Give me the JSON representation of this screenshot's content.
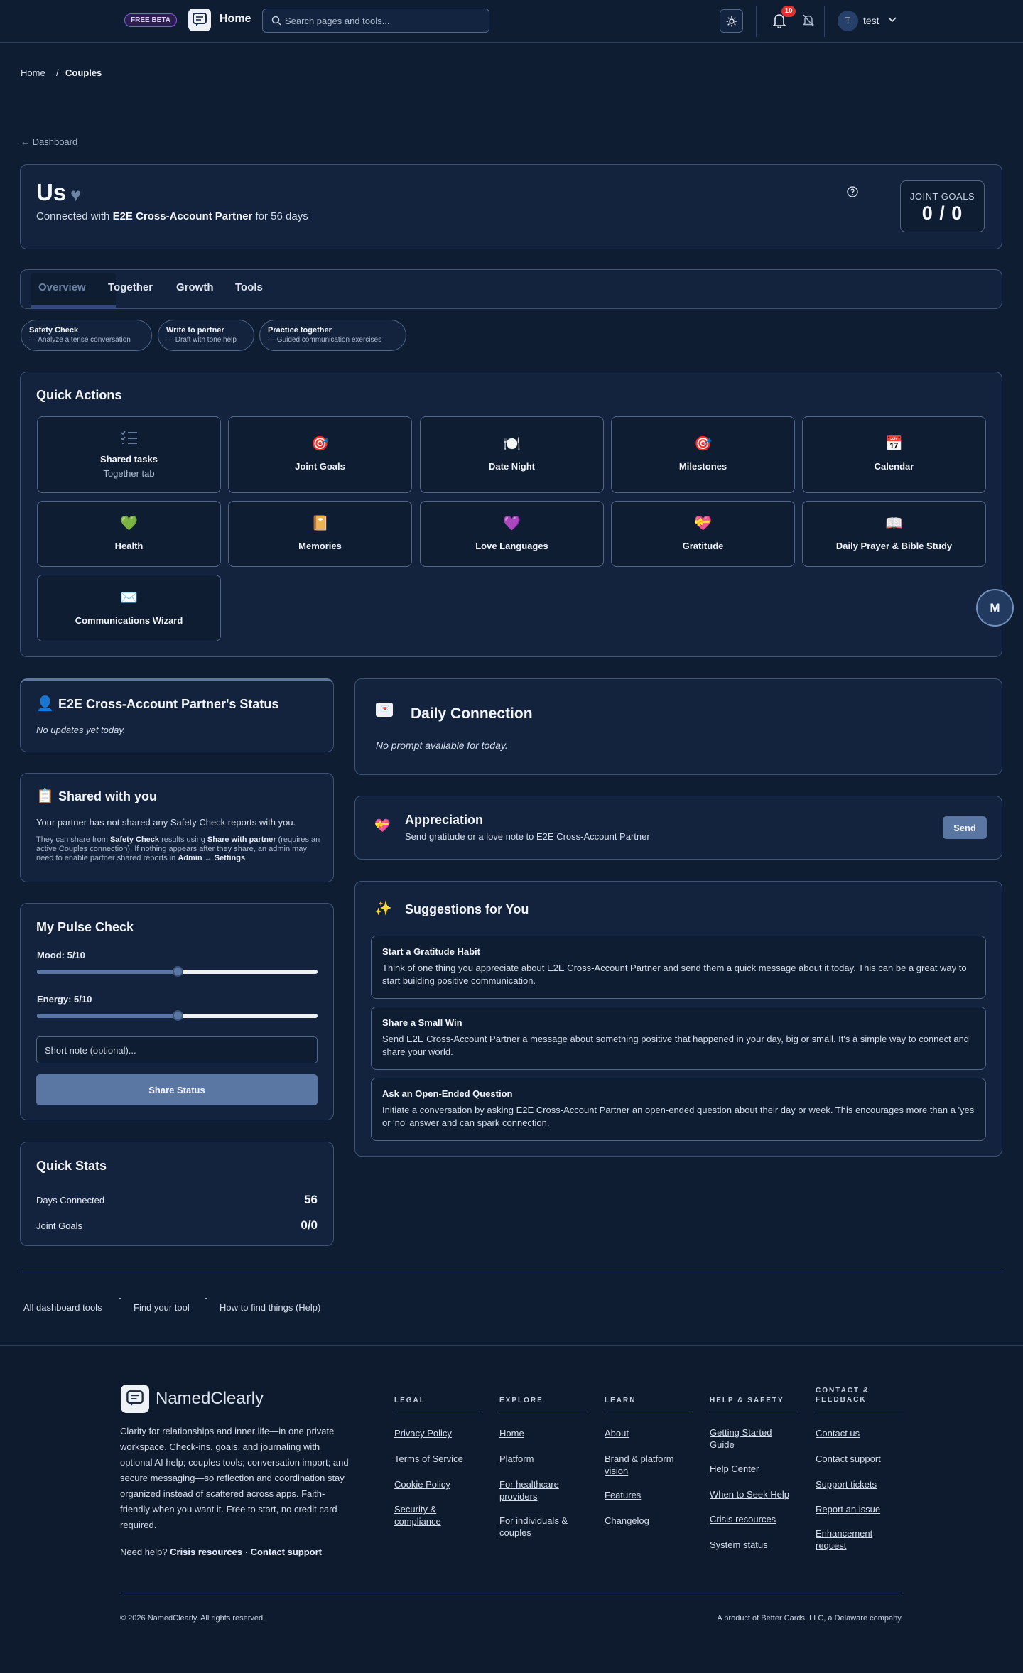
{
  "header": {
    "beta_badge": "FREE BETA",
    "home_label": "Home",
    "search_placeholder": "Search pages and tools...",
    "notifications_count": "10",
    "user_initial": "T",
    "user_name": "test"
  },
  "breadcrumb": {
    "home": "Home",
    "separator": "/",
    "current": "Couples"
  },
  "back_link": "← Dashboard",
  "hero": {
    "title": "Us",
    "heart": "♥",
    "subtitle_prefix": "Connected with ",
    "partner_name": "E2E Cross-Account Partner",
    "subtitle_suffix": " for 56 days",
    "joint_goals_label": "JOINT GOALS",
    "joint_goals_value": "0 / 0"
  },
  "tabs": [
    "Overview",
    "Together",
    "Growth",
    "Tools"
  ],
  "pills": [
    {
      "title": "Safety Check",
      "sub": "— Analyze a tense conversation"
    },
    {
      "title": "Write to partner",
      "sub": "— Draft with tone help"
    },
    {
      "title": "Practice together",
      "sub": "— Guided communication exercises"
    }
  ],
  "quick_actions": {
    "title": "Quick Actions",
    "items": [
      {
        "icon": "🎯",
        "label": "Joint Goals"
      },
      {
        "icon": "🍽️",
        "label": "Date Night"
      },
      {
        "icon": "🎯",
        "label": "Milestones"
      },
      {
        "icon": "📅",
        "label": "Calendar"
      },
      {
        "icon": "💚",
        "label": "Health"
      },
      {
        "icon": "📔",
        "label": "Memories"
      },
      {
        "icon": "💜",
        "label": "Love Languages"
      },
      {
        "icon": "💝",
        "label": "Gratitude"
      },
      {
        "icon": "📖",
        "label": "Daily Prayer & Bible Study"
      },
      {
        "icon": "✉️",
        "label": "Communications Wizard"
      }
    ],
    "shared_tasks": {
      "label": "Shared tasks",
      "sub": "Together tab"
    }
  },
  "floating_button": "M",
  "partner_status": {
    "icon": "👤",
    "title": "E2E Cross-Account Partner's Status",
    "empty": "No updates yet today."
  },
  "shared_with_you": {
    "icon": "📋",
    "title": "Shared with you",
    "text": "Your partner has not shared any Safety Check reports with you.",
    "help_1": "They can share from ",
    "help_b1": "Safety Check",
    "help_2": " results using ",
    "help_b2": "Share with partner",
    "help_3": " (requires an active Couples connection). If nothing appears after they share, an admin may need to enable partner shared reports in ",
    "help_b3": "Admin",
    "help_4": " → ",
    "help_b4": "Settings",
    "help_5": "."
  },
  "pulse": {
    "title": "My Pulse Check",
    "mood_label": "Mood: 5/10",
    "mood_value": 5,
    "energy_label": "Energy: 5/10",
    "energy_value": 5,
    "max": 10,
    "note_placeholder": "Short note (optional)...",
    "share_button": "Share Status"
  },
  "quick_stats": {
    "title": "Quick Stats",
    "rows": [
      {
        "label": "Days Connected",
        "value": "56"
      },
      {
        "label": "Joint Goals",
        "value": "0/0"
      }
    ]
  },
  "daily_connection": {
    "icon": "💌",
    "title": "Daily Connection",
    "empty": "No prompt available for today."
  },
  "appreciation": {
    "icon": "💝",
    "title": "Appreciation",
    "sub": "Send gratitude or a love note to E2E Cross-Account Partner",
    "button": "Send"
  },
  "suggestions": {
    "icon": "✨",
    "title": "Suggestions for You",
    "items": [
      {
        "title": "Start a Gratitude Habit",
        "body": "Think of one thing you appreciate about E2E Cross-Account Partner and send them a quick message about it today. This can be a great way to start building positive communication."
      },
      {
        "title": "Share a Small Win",
        "body": "Send E2E Cross-Account Partner a message about something positive that happened in your day, big or small. It's a simple way to connect and share your world."
      },
      {
        "title": "Ask an Open-Ended Question",
        "body": "Initiate a conversation by asking E2E Cross-Account Partner an open-ended question about their day or week. This encourages more than a 'yes' or 'no' answer and can spark connection."
      }
    ]
  },
  "tool_links": [
    "All dashboard tools",
    "Find your tool",
    "How to find things (Help)"
  ],
  "footer": {
    "brand": "NamedClearly",
    "description": "Clarity for relationships and inner life—in one private workspace. Check-ins, goals, and journaling with optional AI help; couples tools; conversation import; and secure messaging—so reflection and coordination stay organized instead of scattered across apps. Faith-friendly when you want it. Free to start, no credit card required.",
    "help_prefix": "Need help? ",
    "help_crisis": "Crisis resources",
    "help_sep": " · ",
    "help_contact": "Contact support",
    "columns": [
      {
        "title": "LEGAL",
        "links": [
          "Privacy Policy",
          "Terms of Service",
          "Cookie Policy",
          "Security & compliance"
        ]
      },
      {
        "title": "EXPLORE",
        "links": [
          "Home",
          "Platform",
          "For healthcare providers",
          "For individuals & couples"
        ]
      },
      {
        "title": "LEARN",
        "links": [
          "About",
          "Brand & platform vision",
          "Features",
          "Changelog"
        ]
      },
      {
        "title": "HELP & SAFETY",
        "links": [
          "Getting Started Guide",
          "Help Center",
          "When to Seek Help",
          "Crisis resources",
          "System status"
        ]
      },
      {
        "title": "CONTACT & FEEDBACK",
        "links": [
          "Contact us",
          "Contact support",
          "Support tickets",
          "Report an issue",
          "Enhancement request"
        ]
      }
    ],
    "copyright": "© 2026 NamedClearly. All rights reserved.",
    "product": "A product of Better Cards, LLC, a Delaware company."
  }
}
